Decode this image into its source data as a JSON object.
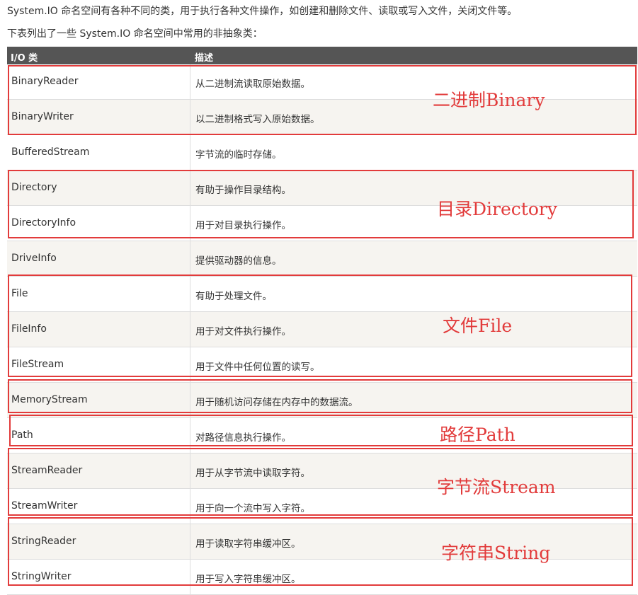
{
  "intro": {
    "line1": "System.IO 命名空间有各种不同的类，用于执行各种文件操作，如创建和删除文件、读取或写入文件，关闭文件等。",
    "line2": "下表列出了一些 System.IO 命名空间中常用的非抽象类："
  },
  "table": {
    "headers": [
      "I/O 类",
      "描述"
    ],
    "rows": [
      {
        "cls": "BinaryReader",
        "desc": "从二进制流读取原始数据。"
      },
      {
        "cls": "BinaryWriter",
        "desc": "以二进制格式写入原始数据。"
      },
      {
        "cls": "BufferedStream",
        "desc": "字节流的临时存储。"
      },
      {
        "cls": "Directory",
        "desc": "有助于操作目录结构。"
      },
      {
        "cls": "DirectoryInfo",
        "desc": "用于对目录执行操作。"
      },
      {
        "cls": "DriveInfo",
        "desc": "提供驱动器的信息。"
      },
      {
        "cls": "File",
        "desc": "有助于处理文件。"
      },
      {
        "cls": "FileInfo",
        "desc": "用于对文件执行操作。"
      },
      {
        "cls": "FileStream",
        "desc": "用于文件中任何位置的读写。"
      },
      {
        "cls": "MemoryStream",
        "desc": "用于随机访问存储在内存中的数据流。"
      },
      {
        "cls": "Path",
        "desc": "对路径信息执行操作。"
      },
      {
        "cls": "StreamReader",
        "desc": "用于从字节流中读取字符。"
      },
      {
        "cls": "StreamWriter",
        "desc": "用于向一个流中写入字符。"
      },
      {
        "cls": "StringReader",
        "desc": "用于读取字符串缓冲区。"
      },
      {
        "cls": "StringWriter",
        "desc": "用于写入字符串缓冲区。"
      }
    ]
  },
  "annotations": {
    "binary": "二进制Binary",
    "directory": "目录Directory",
    "file": "文件File",
    "path": "路径Path",
    "stream": "字节流Stream",
    "string": "字符串String"
  },
  "colors": {
    "header_bg": "#555555",
    "row_alt_bg": "#f6f4f0",
    "annotation_red": "#e23b3b"
  }
}
